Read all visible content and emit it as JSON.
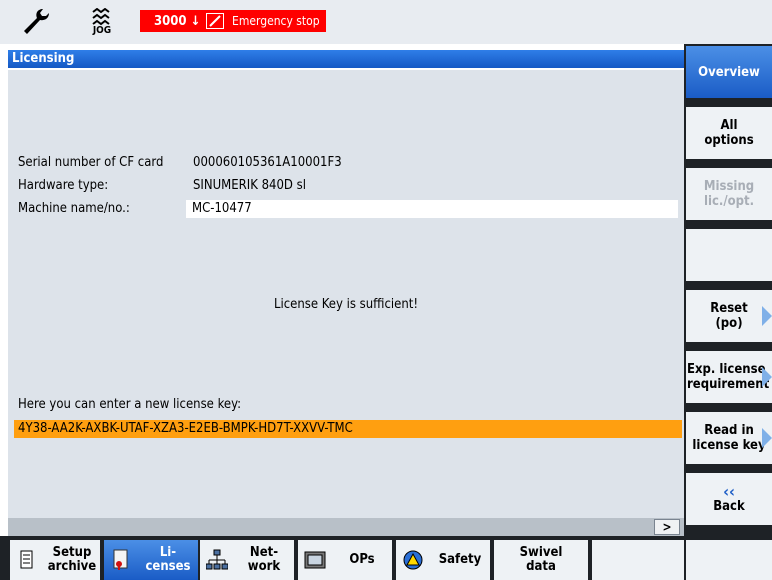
{
  "header": {
    "tool_icon": "wrench-icon",
    "mode_icon": "jog-mode-icon",
    "mode_label": "JOG",
    "alarm_number": "3000",
    "alarm_arrow": "↓",
    "alarm_text": "Emergency stop"
  },
  "title": "Licensing",
  "info": {
    "serial_label": "Serial number of CF card",
    "serial_value": "000060105361A10001F3",
    "hardware_label": "Hardware type:",
    "hardware_value": "SINUMERIK 840D sl",
    "machine_label": "Machine name/no.:",
    "machine_value": "MC-10477"
  },
  "status_message": "License Key is sufficient!",
  "new_key_label": "Here you can enter a new license key:",
  "license_key_value": "4Y38-AA2K-AXBK-UTAF-XZA3-E2EB-BMPK-HD7T-XXVV-TMC",
  "scroll_right": ">",
  "vertical_softkeys": {
    "overview": "Overview",
    "all_options_1": "All",
    "all_options_2": "options",
    "missing_1": "Missing",
    "missing_2": "lic./opt.",
    "reset_1": "Reset",
    "reset_2": "(po)",
    "exp_1": "Exp. license",
    "exp_2": "requirement",
    "readin_1": "Read in",
    "readin_2": "license key",
    "back_icon": "‹‹",
    "back": "Back"
  },
  "horizontal_softkeys": {
    "setup_1": "Setup",
    "setup_2": "archive",
    "lic_1": "Li-",
    "lic_2": "censes",
    "net_1": "Net-",
    "net_2": "work",
    "ops": "OPs",
    "safety": "Safety",
    "swivel_1": "Swivel",
    "swivel_2": "data"
  },
  "colors": {
    "alarm": "#ff0000",
    "title_bar": "#1e6fd6",
    "license_key_field": "#ff9f10",
    "panel_bg": "#dde3ea"
  }
}
